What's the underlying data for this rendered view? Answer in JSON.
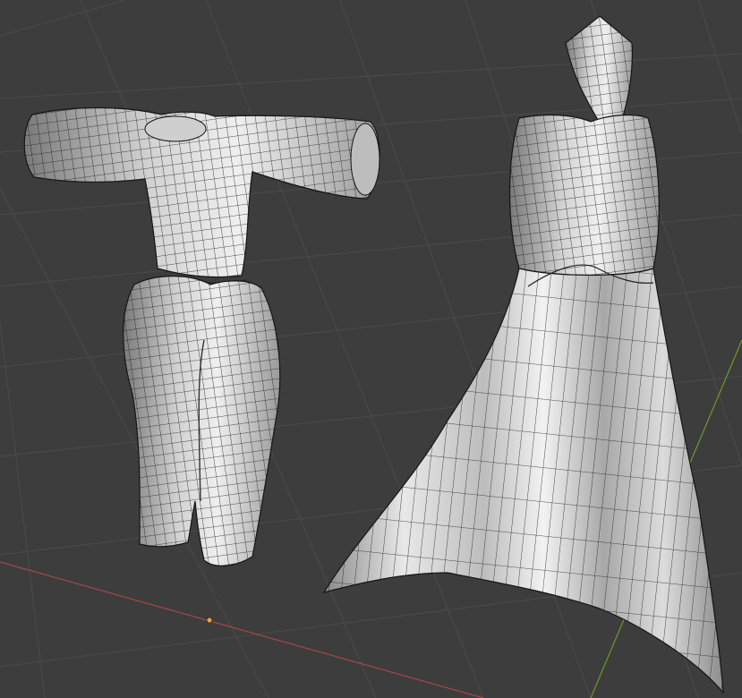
{
  "viewport": {
    "view": "3D Viewport",
    "shading": "solid",
    "overlay": "wireframe",
    "background_color": "#3d3d3d",
    "grid_color": "#4a4a4a",
    "x_axis_color": "#a8454c",
    "y_axis_color": "#6e9a2a",
    "origin_color": "#f0a03a"
  },
  "scene": {
    "objects": [
      {
        "name_icon": "outfit-top-pants-mesh",
        "parts": [
          "shirt",
          "pants"
        ]
      },
      {
        "name_icon": "long-dress-mesh",
        "parts": [
          "hood",
          "bodice",
          "skirt"
        ]
      }
    ]
  }
}
